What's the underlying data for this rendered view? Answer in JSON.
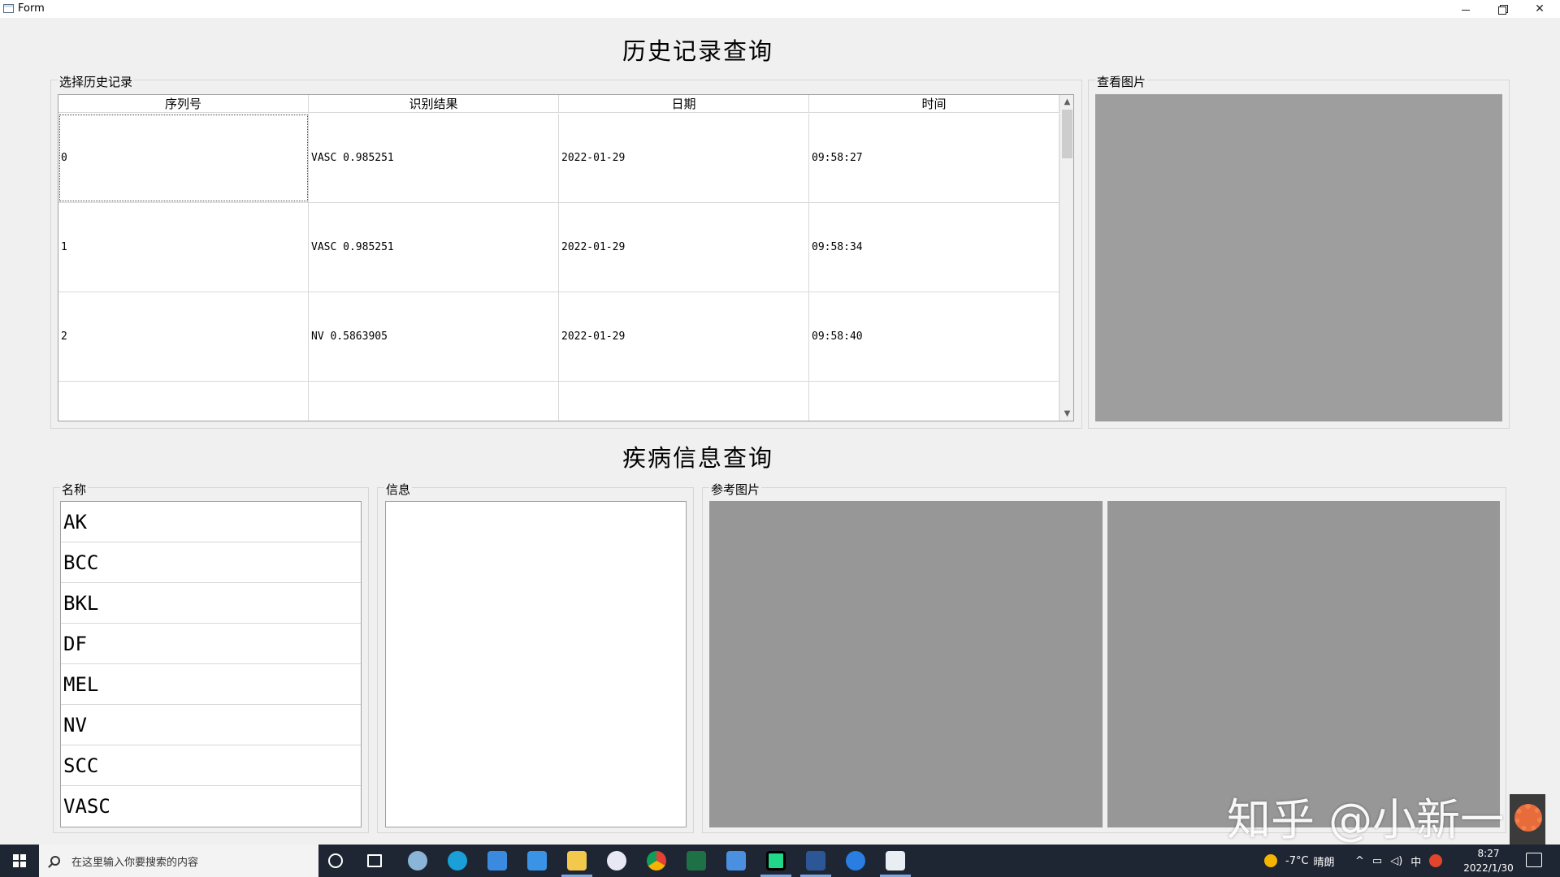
{
  "window": {
    "title": "Form"
  },
  "history": {
    "heading": "历史记录查询",
    "group_label": "选择历史记录",
    "columns": [
      "序列号",
      "识别结果",
      "日期",
      "时间"
    ],
    "rows": [
      [
        "0",
        "VASC 0.985251",
        "2022-01-29",
        "09:58:27"
      ],
      [
        "1",
        "VASC 0.985251",
        "2022-01-29",
        "09:58:34"
      ],
      [
        "2",
        "NV 0.5863905",
        "2022-01-29",
        "09:58:40"
      ]
    ],
    "view_label": "查看图片"
  },
  "disease": {
    "heading": "疾病信息查询",
    "name_label": "名称",
    "names": [
      "AK",
      "BCC",
      "BKL",
      "DF",
      "MEL",
      "NV",
      "SCC",
      "VASC"
    ],
    "info_label": "信息",
    "ref_label": "参考图片"
  },
  "watermark": "知乎 @小新一",
  "taskbar": {
    "search_placeholder": "在这里输入你要搜索的内容",
    "weather_temp": "-7°C",
    "weather_desc": "晴朗",
    "ime": "中",
    "time": "8:27",
    "date": "2022/1/30"
  },
  "colors": {
    "window_bg": "#f0f0f0",
    "picture_placeholder": "#9e9e9e",
    "taskbar_bg": "#1f2633"
  }
}
